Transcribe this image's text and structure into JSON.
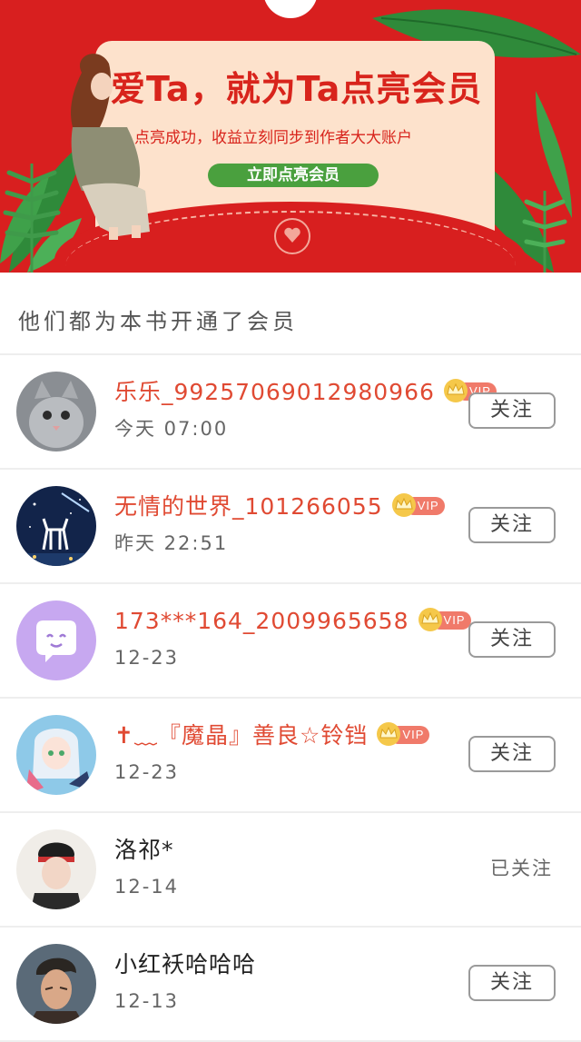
{
  "banner": {
    "title": "爱Ta，就为Ta点亮会员",
    "subtitle": "点亮成功，收益立刻同步到作者大大账户",
    "cta_label": "立即点亮会员"
  },
  "section": {
    "title": "他们都为本书开通了会员"
  },
  "vip_badge_text": "VIP",
  "members": [
    {
      "name": "乐乐_9925706901298096​6",
      "time": "今天 07:00",
      "vip": true,
      "status": "关注"
    },
    {
      "name": "无情的世界_101266055",
      "time": "昨天 22:51",
      "vip": true,
      "status": "关注"
    },
    {
      "name": "173***164_2009965658",
      "time": "12-23",
      "vip": true,
      "status": "关注"
    },
    {
      "name": "✝﹏『魔晶』善良☆铃铛",
      "time": "12-23",
      "vip": true,
      "status": "关注"
    },
    {
      "name": "洛祁*",
      "time": "12-14",
      "vip": false,
      "status": "已关注"
    },
    {
      "name": "小红袄哈哈哈",
      "time": "12-13",
      "vip": false,
      "status": "关注"
    }
  ],
  "colors": {
    "banner_red": "#d81f1f",
    "card_peach": "#fde2cc",
    "cta_green": "#4aa03e",
    "vip_name": "#e04a33",
    "vip_pill": "#f07a6a",
    "crown_gold": "#f5c84a"
  }
}
